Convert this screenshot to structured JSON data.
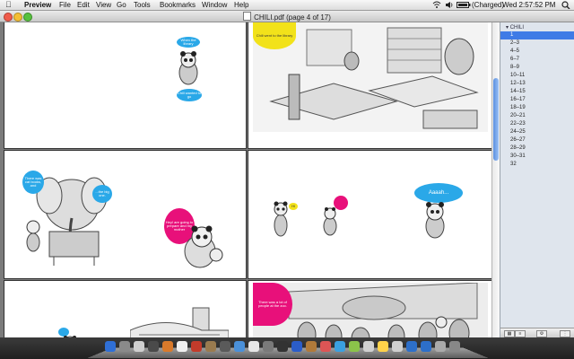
{
  "menubar": {
    "app": "Preview",
    "menus": [
      "File",
      "Edit",
      "View",
      "Go",
      "Tools",
      "Bookmarks",
      "Window",
      "Help"
    ],
    "battery": "(Charged)",
    "clock": "Wed 2:57:52 PM",
    "icons": [
      "apple-icon",
      "wifi-icon",
      "volume-icon",
      "battery-icon",
      "spotlight-icon"
    ]
  },
  "window": {
    "title": "CHILI.pdf (page 4 of 17)"
  },
  "pages": {
    "p1_bubble_top": "When the library",
    "p1_bubble_bottom": "Chili wanted to go",
    "p2_bubble": "Chili went to the library",
    "p3_bubble_left": "There was cat books, and",
    "p3_bubble_right": "...the big one.",
    "p3_bubble_pink": "Hey! are going to prepare and my mother",
    "p4_bubble_yellow": "Hi",
    "p4_bubble_aaaah": "Aaaah...",
    "p6_bubble_pink": "There was a lot of people at the zoo."
  },
  "sidebar": {
    "title": "CHILI",
    "items": [
      "1",
      "2–3",
      "4–5",
      "6–7",
      "8–9",
      "10–11",
      "12–13",
      "14–15",
      "16–17",
      "18–19",
      "20–21",
      "22–23",
      "24–25",
      "26–27",
      "28–29",
      "30–31",
      "32"
    ],
    "selected": "1"
  },
  "colors": {
    "bubble_blue": "#2aa8e8",
    "bubble_pink": "#e8107a",
    "bubble_yellow": "#f2e21a",
    "selection": "#3f7be6"
  }
}
